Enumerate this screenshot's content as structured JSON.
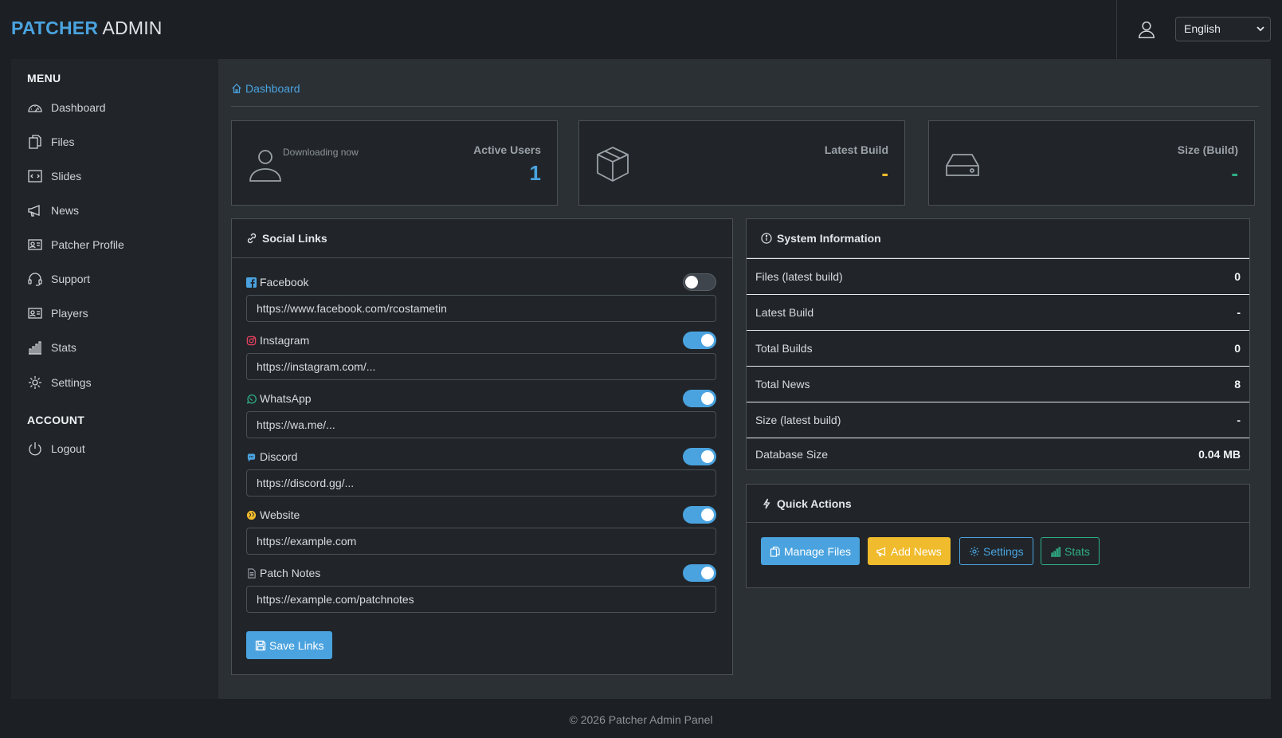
{
  "brand": {
    "part1": "PATCHER",
    "part2": "ADMIN"
  },
  "header": {
    "language": "English"
  },
  "sidebar": {
    "menu_heading": "MENU",
    "account_heading": "ACCOUNT",
    "items": [
      {
        "label": "Dashboard",
        "icon": "dashboard-icon"
      },
      {
        "label": "Files",
        "icon": "files-icon"
      },
      {
        "label": "Slides",
        "icon": "slides-icon"
      },
      {
        "label": "News",
        "icon": "megaphone-icon"
      },
      {
        "label": "Patcher Profile",
        "icon": "profile-card-icon"
      },
      {
        "label": "Support",
        "icon": "headset-icon"
      },
      {
        "label": "Players",
        "icon": "players-card-icon"
      },
      {
        "label": "Stats",
        "icon": "bar-chart-icon"
      },
      {
        "label": "Settings",
        "icon": "gear-icon"
      }
    ],
    "account_items": [
      {
        "label": "Logout",
        "icon": "power-icon"
      }
    ]
  },
  "breadcrumb": {
    "label": "Dashboard"
  },
  "stats": {
    "active_users": {
      "title": "Active Users",
      "subtitle": "Downloading now",
      "value": "1",
      "color": "#4aa3df"
    },
    "latest_build": {
      "title": "Latest Build",
      "value": "-",
      "color": "#f0bb2c"
    },
    "size_build": {
      "title": "Size (Build)",
      "value": "-",
      "color": "#2fae85"
    }
  },
  "social": {
    "title": "Social Links",
    "links": [
      {
        "label": "Facebook",
        "value": "https://www.facebook.com/rcostametin",
        "enabled": false
      },
      {
        "label": "Instagram",
        "value": "https://instagram.com/...",
        "enabled": true
      },
      {
        "label": "WhatsApp",
        "value": "https://wa.me/...",
        "enabled": true
      },
      {
        "label": "Discord",
        "value": "https://discord.gg/...",
        "enabled": true
      },
      {
        "label": "Website",
        "value": "https://example.com",
        "enabled": true
      },
      {
        "label": "Patch Notes",
        "value": "https://example.com/patchnotes",
        "enabled": true
      }
    ],
    "save_label": "Save Links"
  },
  "system": {
    "title": "System Information",
    "rows": [
      {
        "label": "Files (latest build)",
        "value": "0"
      },
      {
        "label": "Latest Build",
        "value": "-"
      },
      {
        "label": "Total Builds",
        "value": "0"
      },
      {
        "label": "Total News",
        "value": "8"
      },
      {
        "label": "Size (latest build)",
        "value": "-"
      },
      {
        "label": "Database Size",
        "value": "0.04 MB"
      }
    ]
  },
  "quick_actions": {
    "title": "Quick Actions",
    "manage_files": "Manage Files",
    "add_news": "Add News",
    "settings": "Settings",
    "stats": "Stats"
  },
  "footer": {
    "text": "© 2026 Patcher Admin Panel"
  },
  "colors": {
    "accent": "#4aa3df",
    "warning": "#f0bb2c",
    "success": "#2fae85"
  }
}
